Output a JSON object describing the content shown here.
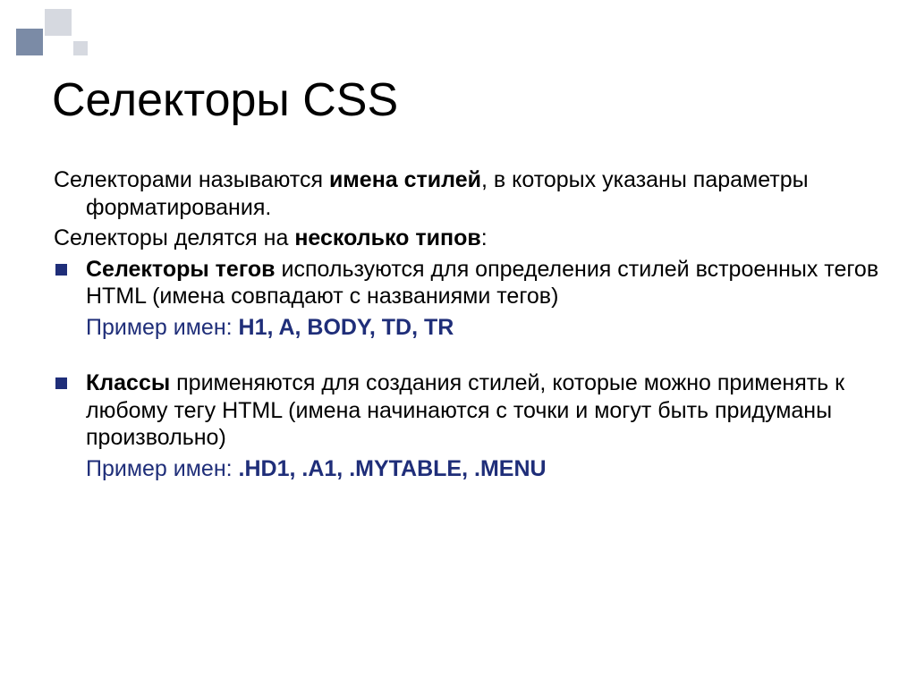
{
  "title": "Селекторы CSS",
  "intro": {
    "prefix": "Селекторами называются ",
    "bold": "имена стилей",
    "suffix": ", в которых указаны параметры форматирования."
  },
  "divide": {
    "prefix": "Селекторы делятся на ",
    "bold": "несколько типов",
    "suffix": ":"
  },
  "item1": {
    "bold": "Селекторы тегов",
    "rest": " используются для определения стилей встроенных тегов HTML (имена совпадают с названиями тегов)"
  },
  "example1": {
    "label": "Пример имен: ",
    "names": "H1, A, BODY, TD, TR"
  },
  "item2": {
    "bold": "Классы",
    "rest": " применяются для создания стилей, которые можно применять к любому тегу HTML (имена начинаются с точки и могут быть придуманы произвольно)"
  },
  "example2": {
    "label": "Пример имен: ",
    "names": ".HD1, .A1, .MYTABLE, .MENU"
  }
}
